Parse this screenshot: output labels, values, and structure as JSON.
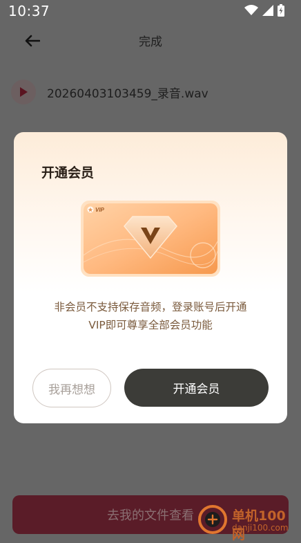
{
  "status_bar": {
    "time": "10:37"
  },
  "header": {
    "title": "完成"
  },
  "file": {
    "name": "20260403103459_录音.wav"
  },
  "bottom": {
    "button_label": "去我的文件查看"
  },
  "dialog": {
    "title": "开通会员",
    "card_badge": "VIP",
    "message_line1": "非会员不支持保存音频，登录账号后开通",
    "message_line2": "VIP即可尊享全部会员功能",
    "cancel_label": "我再想想",
    "confirm_label": "开通会员"
  },
  "watermark": {
    "text": "单机100网",
    "url": "danji100.com"
  },
  "colors": {
    "overlay": "#666666",
    "confirm": "#3c3c38",
    "accent": "#f2a062",
    "bottom_button": "#5a1c28"
  }
}
